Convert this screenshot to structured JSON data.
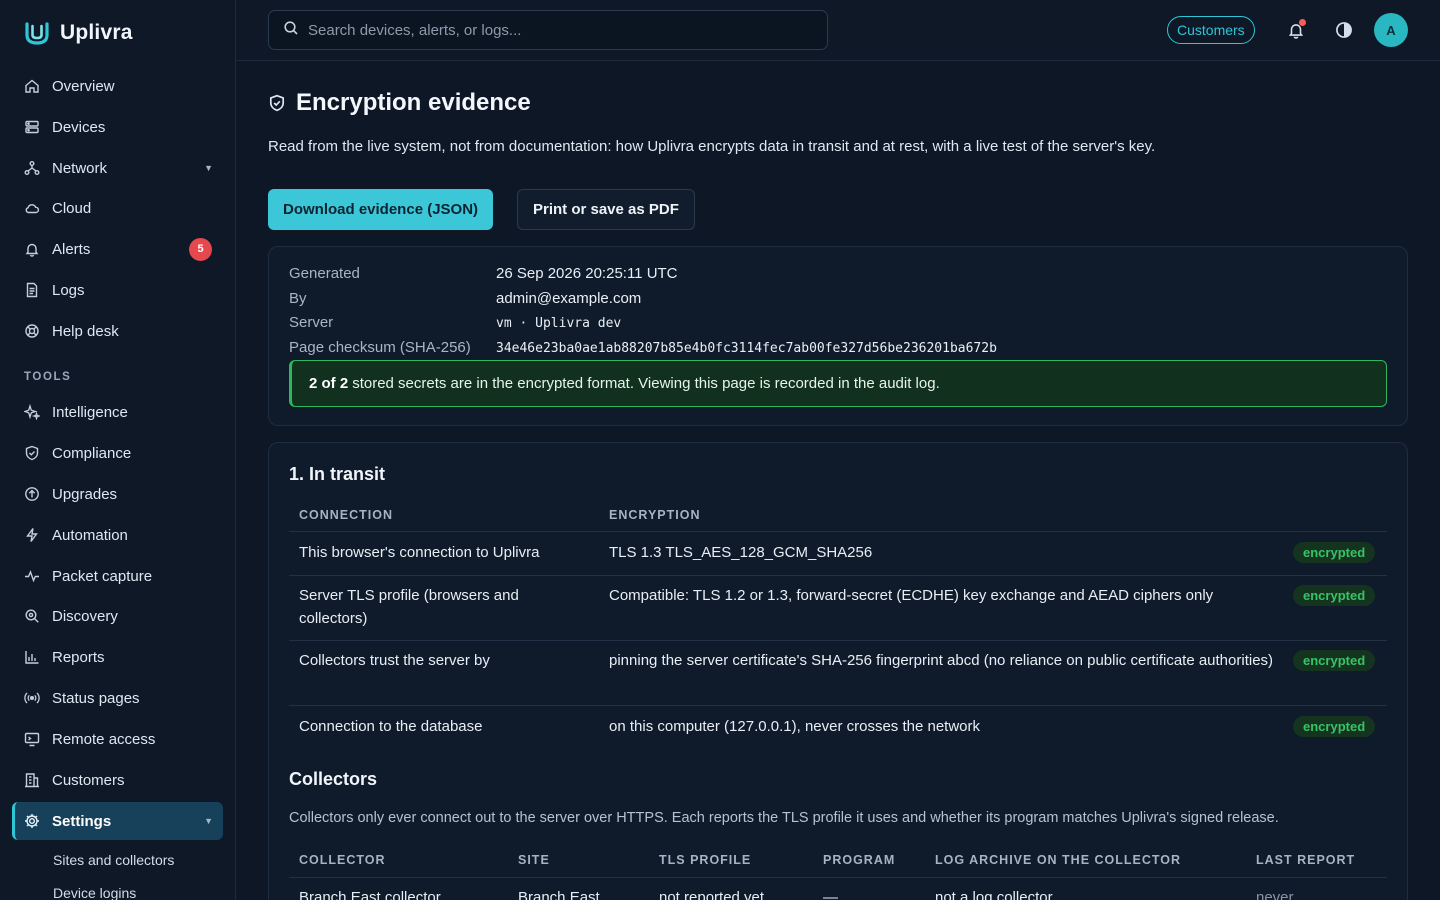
{
  "brand": {
    "name": "Uplivra"
  },
  "nav": {
    "items": [
      {
        "label": "Overview",
        "icon": "home-icon"
      },
      {
        "label": "Devices",
        "icon": "server-icon"
      },
      {
        "label": "Network",
        "icon": "network-icon"
      },
      {
        "label": "Cloud",
        "icon": "cloud-icon"
      },
      {
        "label": "Alerts",
        "icon": "bell-icon",
        "badge": "5"
      },
      {
        "label": "Logs",
        "icon": "file-icon"
      },
      {
        "label": "Help desk",
        "icon": "lifebuoy-icon"
      }
    ],
    "tools_label": "TOOLS",
    "tools": [
      {
        "label": "Intelligence",
        "icon": "sparkles-icon"
      },
      {
        "label": "Compliance",
        "icon": "shield-check-icon"
      },
      {
        "label": "Upgrades",
        "icon": "arrow-up-circle-icon"
      },
      {
        "label": "Automation",
        "icon": "bolt-icon"
      },
      {
        "label": "Packet capture",
        "icon": "activity-icon"
      },
      {
        "label": "Discovery",
        "icon": "search-icon"
      },
      {
        "label": "Reports",
        "icon": "bar-chart-icon"
      },
      {
        "label": "Status pages",
        "icon": "broadcast-icon"
      },
      {
        "label": "Remote access",
        "icon": "monitor-icon"
      },
      {
        "label": "Customers",
        "icon": "building-icon"
      },
      {
        "label": "Settings",
        "icon": "gear-icon",
        "active": true
      }
    ],
    "settings_sub": [
      "Sites and collectors",
      "Device logins"
    ]
  },
  "topbar": {
    "search_placeholder": "Search devices, alerts, or logs...",
    "customers_label": "Customers",
    "avatar_initial": "A"
  },
  "page": {
    "title": "Encryption evidence",
    "description": "Read from the live system, not from documentation: how Uplivra encrypts data in transit and at rest, with a live test of the server's key.",
    "download_label": "Download evidence (JSON)",
    "print_label": "Print or save as PDF"
  },
  "meta": {
    "rows": [
      {
        "key": "Generated",
        "value": "26 Sep 2026 20:25:11 UTC"
      },
      {
        "key": "By",
        "value": "admin@example.com"
      },
      {
        "key": "Server",
        "value": "vm · Uplivra dev"
      },
      {
        "key": "Page checksum (SHA-256)",
        "value": "34e46e23ba0ae1ab88207b85e4b0fc3114fec7ab00fe327d56be236201ba672b"
      }
    ],
    "banner_strong": "2 of 2",
    "banner_text": "stored secrets are in the encrypted format. Viewing this page is recorded in the audit log."
  },
  "transit": {
    "title": "1. In transit",
    "headers": [
      "CONNECTION",
      "ENCRYPTION"
    ],
    "rows": [
      {
        "connection": "This browser's connection to Uplivra",
        "encryption": "TLS 1.3 TLS_AES_128_GCM_SHA256",
        "status": "encrypted"
      },
      {
        "connection": "Server TLS profile (browsers and collectors)",
        "encryption": "Compatible: TLS 1.2 or 1.3, forward-secret (ECDHE) key exchange and AEAD ciphers only",
        "status": "encrypted"
      },
      {
        "connection": "Collectors trust the server by",
        "encryption": "pinning the server certificate's SHA-256 fingerprint abcd (no reliance on public certificate authorities)",
        "status": "encrypted"
      },
      {
        "connection": "Connection to the database",
        "encryption": "on this computer (127.0.0.1), never crosses the network",
        "status": "encrypted"
      }
    ]
  },
  "collectors": {
    "title": "Collectors",
    "description": "Collectors only ever connect out to the server over HTTPS. Each reports the TLS profile it uses and whether its program matches Uplivra's signed release.",
    "headers": [
      "COLLECTOR",
      "SITE",
      "TLS PROFILE",
      "PROGRAM",
      "LOG ARCHIVE ON THE COLLECTOR",
      "LAST REPORT"
    ],
    "rows": [
      [
        "Branch East collector",
        "Branch East",
        "not reported yet",
        "—",
        "not a log collector",
        "never"
      ]
    ]
  },
  "colors": {
    "accent": "#2ec6d6",
    "success": "#35c466",
    "danger": "#e5484d",
    "background": "#0d1726"
  }
}
